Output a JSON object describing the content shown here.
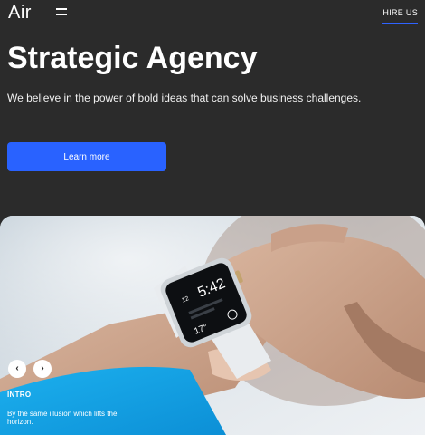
{
  "header": {
    "logo": "Air",
    "menu_icon": "hamburger-icon",
    "hire_label": "HIRE US",
    "accent_color": "#2f63ff"
  },
  "hero": {
    "title": "Strategic Agency",
    "tagline": "We believe in the power of bold ideas that can solve business challenges.",
    "cta_label": "Learn more",
    "cta_color": "#2962ff"
  },
  "slider": {
    "prev_icon": "chevron-left-icon",
    "next_icon": "chevron-right-icon",
    "prev_glyph": "‹",
    "next_glyph": "›",
    "slide_tag": "INTRO",
    "slide_description": "By the same illusion which lifts the horizon.",
    "watch": {
      "time": "5:42",
      "hour_small": "12",
      "temp": "17°"
    }
  },
  "colors": {
    "background": "#2b2b2b",
    "sleeve": "#18a6e6"
  }
}
